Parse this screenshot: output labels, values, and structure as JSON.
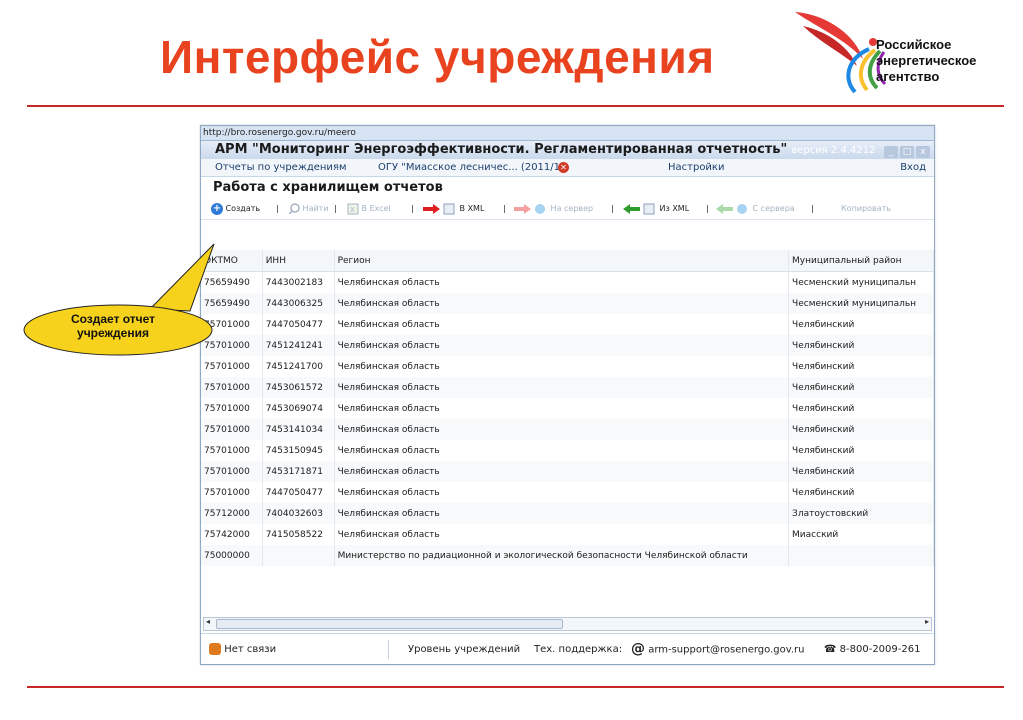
{
  "slide": {
    "title": "Интерфейс учреждения",
    "logo_text": [
      "Российское",
      "энергетическое",
      "агентство"
    ]
  },
  "window": {
    "url": "http://bro.rosenergo.gov.ru/meero",
    "title": "АРМ \"Мониторинг Энергоэффективности. Регламентированная отчетность\"",
    "version": "версия 2.4.4212",
    "controls": [
      "_",
      "□",
      "x"
    ]
  },
  "nav": {
    "tab_reports": "Отчеты по учреждениям",
    "tab_org": "ОГУ \"Миасское лесничес... (2011/1)",
    "tab_settings": "Настройки",
    "login": "Вход"
  },
  "section_title": "Работа с хранилищем отчетов",
  "toolbar": {
    "create": "Создать",
    "find": "Найти",
    "excel": "В Excel",
    "to_xml": "В XML",
    "to_server": "На сервер",
    "from_xml": "Из XML",
    "from_server": "С сервера",
    "copy": "Копировать"
  },
  "table": {
    "headers": [
      "ОКТМО",
      "ИНН",
      "Регион",
      "Муниципальный район"
    ],
    "rows": [
      [
        "75659490",
        "7443002183",
        "Челябинская область",
        "Чесменский муниципальн"
      ],
      [
        "75659490",
        "7443006325",
        "Челябинская область",
        "Чесменский муниципальн"
      ],
      [
        "75701000",
        "7447050477",
        "Челябинская область",
        "Челябинский"
      ],
      [
        "75701000",
        "7451241241",
        "Челябинская область",
        "Челябинский"
      ],
      [
        "75701000",
        "7451241700",
        "Челябинская область",
        "Челябинский"
      ],
      [
        "75701000",
        "7453061572",
        "Челябинская область",
        "Челябинский"
      ],
      [
        "75701000",
        "7453069074",
        "Челябинская область",
        "Челябинский"
      ],
      [
        "75701000",
        "7453141034",
        "Челябинская область",
        "Челябинский"
      ],
      [
        "75701000",
        "7453150945",
        "Челябинская область",
        "Челябинский"
      ],
      [
        "75701000",
        "7453171871",
        "Челябинская область",
        "Челябинский"
      ],
      [
        "75701000",
        "7447050477",
        "Челябинская область",
        "Челябинский"
      ],
      [
        "75712000",
        "7404032603",
        "Челябинская область",
        "Златоустовский"
      ],
      [
        "75742000",
        "7415058522",
        "Челябинская область",
        "Миасский"
      ],
      [
        "75000000",
        "",
        "Министерство по радиационной и экологической безопасности Челябинской области",
        ""
      ]
    ]
  },
  "status": {
    "connection": "Нет связи",
    "level": "Уровень учреждений",
    "support_label": "Тех. поддержка:",
    "support_email": "arm-support@rosenergo.gov.ru",
    "phone": "8-800-2009-261"
  },
  "callout": {
    "text": "Создает отчет учреждения"
  },
  "colors": {
    "title_red": "#e8421e",
    "rule_red": "#c62828",
    "callout_yellow": "#f7d21c"
  }
}
